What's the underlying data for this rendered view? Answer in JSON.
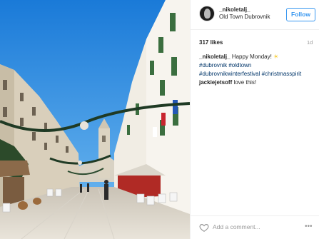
{
  "post": {
    "username": "_nikoletalj_",
    "location": "Old Town Dubrovnik",
    "follow_label": "Follow",
    "likes": "317 likes",
    "age": "1d",
    "caption": {
      "user": "_nikoletalj_",
      "text": "Happy Monday!",
      "emoji": "☀",
      "hashtags_line1": "#dubrovnik #oldtown",
      "hashtags_line2": "#dubrovnikwinterfestival #christmasspirit"
    },
    "comment": {
      "user": "jackiejetsoff",
      "text": "love this!"
    },
    "add_comment_placeholder": "Add a comment...",
    "more_label": "•••"
  },
  "colors": {
    "link": "#003569",
    "follow_blue": "#3897f0",
    "sky": "#2b8ce0"
  }
}
